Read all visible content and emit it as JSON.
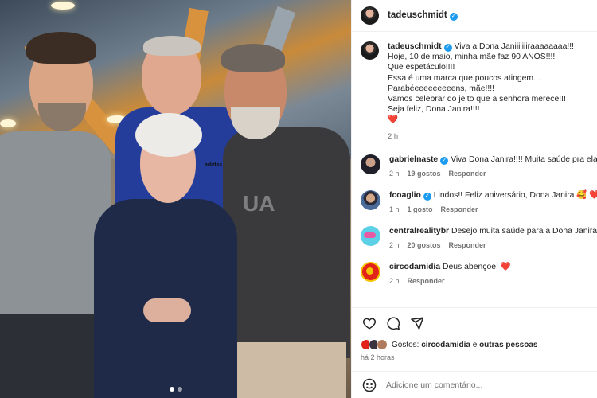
{
  "post": {
    "author": {
      "username": "tadeuschmidt",
      "verified": true
    },
    "photo": {
      "tshirt_print": "UA",
      "jacket_logo": "adidas",
      "carousel_dots": 2,
      "active_dot": 0
    },
    "caption": {
      "username": "tadeuschmidt",
      "lines": [
        "Viva a Dona Janiiiiiiiraaaaaaaa!!!",
        "Hoje, 10 de maio, minha mãe faz 90 ANOS!!!!",
        "Que espetáculo!!!!",
        "Essa é uma marca que poucos atingem...",
        "Parabéeeeeeeeeens, mãe!!!!",
        "Vamos celebrar do jeito que a senhora merece!!!",
        "Seja feliz, Dona Janira!!!!",
        "❤️"
      ],
      "time": "2 h"
    },
    "comments": [
      {
        "username": "gabrielnaste",
        "verified": true,
        "text": "Viva Dona Janira!!!! Muita saúde pra ela!",
        "time": "2 h",
        "likes": "19 gostos",
        "reply": "Responder",
        "avatar": "gab"
      },
      {
        "username": "fcoaglio",
        "verified": true,
        "text": "Lindos!! Feliz aniversário, Dona Janira 🥰 ❤️",
        "time": "1 h",
        "likes": "1 gosto",
        "reply": "Responder",
        "avatar": "fco"
      },
      {
        "username": "centralrealitybr",
        "verified": false,
        "text": "Desejo muita saúde para a Dona Janira!",
        "time": "2 h",
        "likes": "20 gostos",
        "reply": "Responder",
        "avatar": "cen"
      },
      {
        "username": "circodamidia",
        "verified": false,
        "text": "Deus abençoe! ❤️",
        "time": "2 h",
        "likes": "",
        "reply": "Responder",
        "avatar": "cir"
      }
    ],
    "likes_summary": {
      "prefix": "Gostos:",
      "first": "circodamidia",
      "conj": "e",
      "rest": "outras pessoas"
    },
    "posted_ago": "há 2 horas",
    "add_comment_placeholder": "Adicione um comentário...",
    "icons": {
      "like": "heart-outline-icon",
      "comment": "speech-bubble-icon",
      "share": "paper-plane-icon",
      "emoji": "smiley-icon",
      "verified": "verified-badge-icon"
    },
    "colors": {
      "verified": "#1d9bf0",
      "heart": "#ed1c3a",
      "muted": "#737373",
      "text": "#262626"
    }
  }
}
